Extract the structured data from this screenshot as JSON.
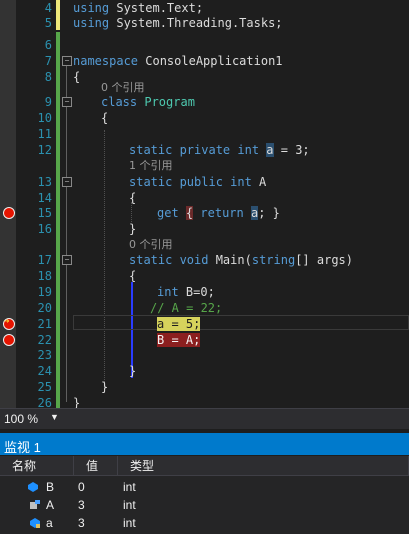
{
  "editor": {
    "lines": [
      {
        "num": "4",
        "code": "using System.Text;"
      },
      {
        "num": "5",
        "code": "using System.Threading.Tasks;"
      },
      {
        "num": "6",
        "code": ""
      },
      {
        "num": "7",
        "code": "namespace ConsoleApplication1"
      },
      {
        "num": "8",
        "code": "{"
      },
      {
        "num": "9",
        "code": "class Program"
      },
      {
        "num": "10",
        "code": "{"
      },
      {
        "num": "11",
        "code": ""
      },
      {
        "num": "12",
        "code": "static private int a = 3;"
      },
      {
        "num": "13",
        "code": "static public int A"
      },
      {
        "num": "14",
        "code": "{"
      },
      {
        "num": "15",
        "code": "get { return a; }"
      },
      {
        "num": "16",
        "code": "}"
      },
      {
        "num": "17",
        "code": "static void Main(string[] args)"
      },
      {
        "num": "18",
        "code": "{"
      },
      {
        "num": "19",
        "code": "int B=0;"
      },
      {
        "num": "20",
        "code": "// A = 22;"
      },
      {
        "num": "21",
        "code": "a = 5;"
      },
      {
        "num": "22",
        "code": "B = A;"
      },
      {
        "num": "23",
        "code": ""
      },
      {
        "num": "24",
        "code": "}"
      },
      {
        "num": "25",
        "code": "}"
      },
      {
        "num": "26",
        "code": "}"
      }
    ],
    "references": {
      "class_refs": "0 个引用",
      "a_refs": "1 个引用",
      "main_refs": "0 个引用"
    },
    "breakpoint_color": "#e51400",
    "exec_highlight_color": "#d6d35c"
  },
  "zoom": {
    "value": "100 %"
  },
  "watch": {
    "title": "监视 1",
    "columns": [
      "名称",
      "值",
      "类型"
    ],
    "rows": [
      {
        "name": "B",
        "value": "0",
        "type": "int",
        "icon": "field-icon"
      },
      {
        "name": "A",
        "value": "3",
        "type": "int",
        "icon": "property-icon"
      },
      {
        "name": "a",
        "value": "3",
        "type": "int",
        "icon": "field-private-icon"
      }
    ]
  }
}
